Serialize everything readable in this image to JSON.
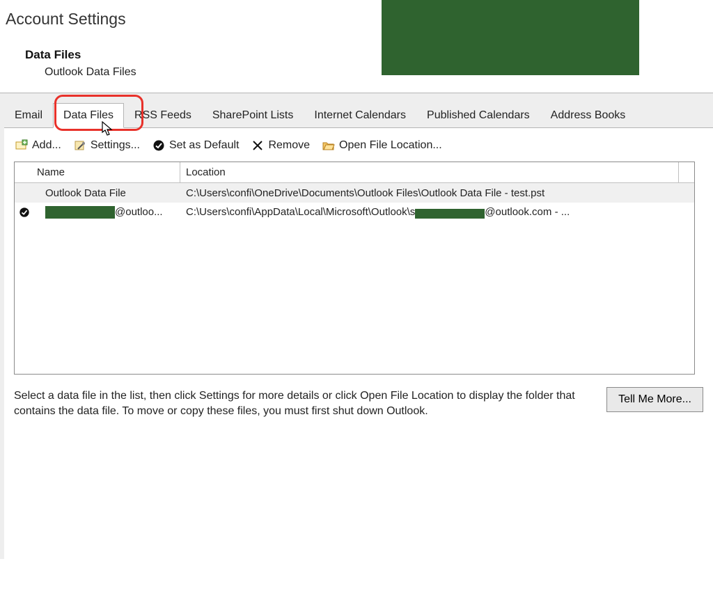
{
  "header": {
    "title": "Account Settings",
    "section": "Data Files",
    "subtitle": "Outlook Data Files"
  },
  "tabs": {
    "items": [
      {
        "label": "Email",
        "active": false
      },
      {
        "label": "Data Files",
        "active": true
      },
      {
        "label": "RSS Feeds",
        "active": false
      },
      {
        "label": "SharePoint Lists",
        "active": false
      },
      {
        "label": "Internet Calendars",
        "active": false
      },
      {
        "label": "Published Calendars",
        "active": false
      },
      {
        "label": "Address Books",
        "active": false
      }
    ]
  },
  "toolbar": {
    "add": "Add...",
    "settings": "Settings...",
    "default": "Set as Default",
    "remove": "Remove",
    "open": "Open File Location..."
  },
  "table": {
    "columns": {
      "name": "Name",
      "location": "Location"
    },
    "rows": [
      {
        "default": false,
        "name": "Outlook Data File",
        "name_redacted": false,
        "location_pre": "C:\\Users\\confi\\OneDrive\\Documents\\Outlook Files\\Outlook Data File - test.pst",
        "location_post": "",
        "loc_redacted": false,
        "selected": true
      },
      {
        "default": true,
        "name": "@outloo...",
        "name_redacted": true,
        "location_pre": "C:\\Users\\confi\\AppData\\Local\\Microsoft\\Outlook\\s",
        "location_post": "@outlook.com - ...",
        "loc_redacted": true,
        "selected": false
      }
    ]
  },
  "help": {
    "text": "Select a data file in the list, then click Settings for more details or click Open File Location to display the folder that contains the data file. To move or copy these files, you must first shut down Outlook.",
    "button": "Tell Me More..."
  }
}
